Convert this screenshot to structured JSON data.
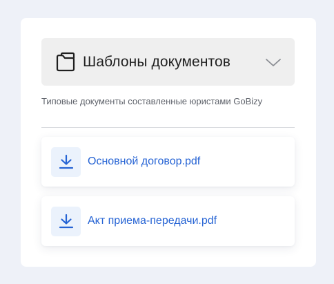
{
  "section": {
    "title": "Шаблоны документов",
    "description": "Типовые документы составленные юристами GoBizy",
    "icons": {
      "header": "folder-icon",
      "toggle": "chevron-down-icon",
      "file": "download-icon"
    }
  },
  "files": [
    {
      "name": "Основной договор.pdf"
    },
    {
      "name": "Акт приема-передачи.pdf"
    }
  ],
  "colors": {
    "page_background": "#eef1f8",
    "card_background": "#ffffff",
    "header_background": "#efefef",
    "link": "#2563d4",
    "icon_box": "#ebf2fc"
  }
}
